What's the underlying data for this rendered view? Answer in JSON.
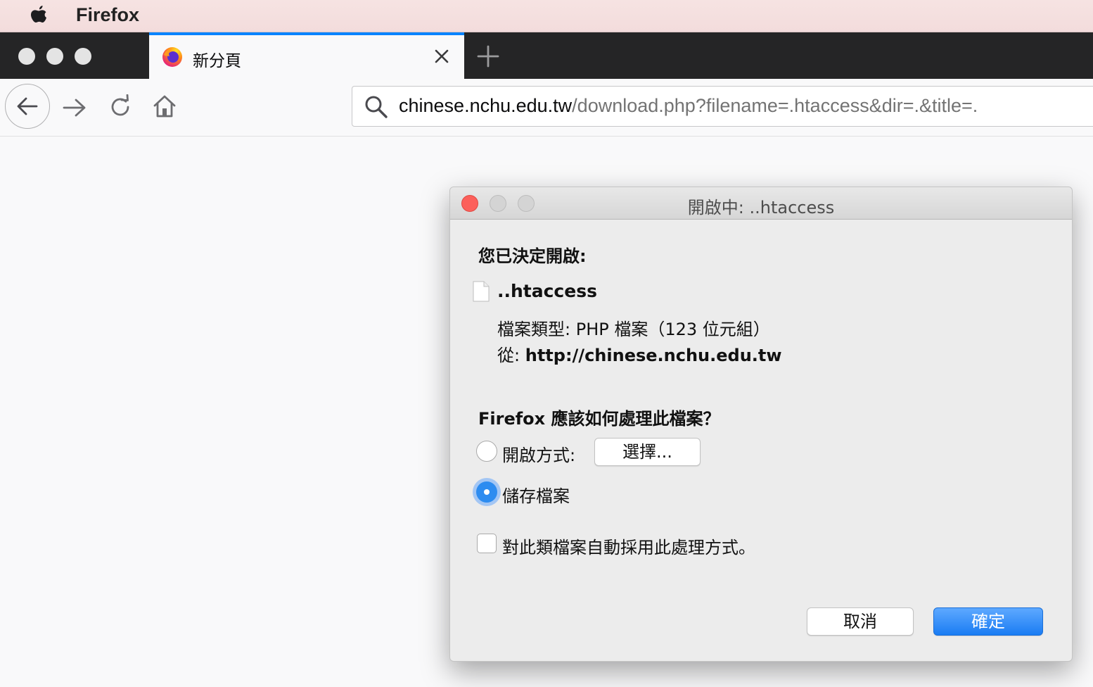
{
  "menubar": {
    "app_name": "Firefox"
  },
  "tab": {
    "title": "新分頁"
  },
  "urlbar": {
    "host": "chinese.nchu.edu.tw",
    "path": "/download.php?filename=.htaccess&dir=.&title=."
  },
  "dialog": {
    "title": "開啟中: ..htaccess",
    "heading": "您已決定開啟:",
    "filename": "..htaccess",
    "file_type_label": "檔案類型:",
    "file_type_value": "PHP 檔案（123 位元組）",
    "from_label": "從:",
    "from_value": "http://chinese.nchu.edu.tw",
    "question": "Firefox 應該如何處理此檔案？",
    "open_with_label": "開啟方式:",
    "choose_button": "選擇...",
    "save_file_label": "儲存檔案",
    "remember_label": "對此類檔案自動採用此處理方式。",
    "cancel_button": "取消",
    "ok_button": "確定",
    "selected_option": "save_file"
  },
  "colors": {
    "tab_accent": "#0a84ff",
    "primary_button": "#1a7cf3",
    "close_dot": "#fc605b"
  }
}
